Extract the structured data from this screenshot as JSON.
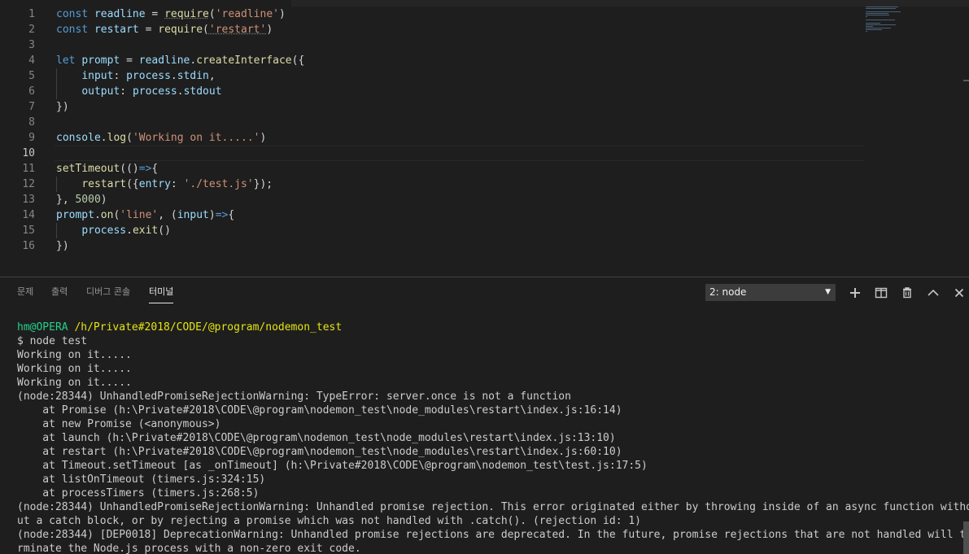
{
  "editor": {
    "current_line": 10,
    "lines": [
      {
        "n": "1",
        "tokens": [
          [
            "kw",
            "const "
          ],
          [
            "var",
            "readline"
          ],
          [
            "punc",
            " = "
          ],
          [
            "fn squig",
            "require"
          ],
          [
            "punc",
            "("
          ],
          [
            "str",
            "'readline'"
          ],
          [
            "punc",
            ")"
          ]
        ]
      },
      {
        "n": "2",
        "tokens": [
          [
            "kw",
            "const "
          ],
          [
            "var",
            "restart"
          ],
          [
            "punc",
            " = "
          ],
          [
            "fn",
            "require"
          ],
          [
            "punc",
            "("
          ],
          [
            "str squig",
            "'restart'"
          ],
          [
            "punc",
            ")"
          ]
        ]
      },
      {
        "n": "3",
        "tokens": []
      },
      {
        "n": "4",
        "tokens": [
          [
            "kw",
            "let "
          ],
          [
            "var",
            "prompt"
          ],
          [
            "punc",
            " = "
          ],
          [
            "var",
            "readline"
          ],
          [
            "punc",
            "."
          ],
          [
            "fn",
            "createInterface"
          ],
          [
            "punc",
            "({"
          ]
        ]
      },
      {
        "n": "5",
        "tokens": [
          [
            "punc",
            "    "
          ],
          [
            "var",
            "input"
          ],
          [
            "punc",
            ": "
          ],
          [
            "var",
            "process"
          ],
          [
            "punc",
            "."
          ],
          [
            "var",
            "stdin"
          ],
          [
            "punc",
            ","
          ]
        ]
      },
      {
        "n": "6",
        "tokens": [
          [
            "punc",
            "    "
          ],
          [
            "var",
            "output"
          ],
          [
            "punc",
            ": "
          ],
          [
            "var",
            "process"
          ],
          [
            "punc",
            "."
          ],
          [
            "var",
            "stdout"
          ]
        ]
      },
      {
        "n": "7",
        "tokens": [
          [
            "punc",
            "})"
          ]
        ]
      },
      {
        "n": "8",
        "tokens": []
      },
      {
        "n": "9",
        "tokens": [
          [
            "var",
            "console"
          ],
          [
            "punc",
            "."
          ],
          [
            "fn",
            "log"
          ],
          [
            "punc",
            "("
          ],
          [
            "str",
            "'Working on it.....'"
          ],
          [
            "punc",
            ")"
          ]
        ]
      },
      {
        "n": "10",
        "tokens": []
      },
      {
        "n": "11",
        "tokens": [
          [
            "fn",
            "setTimeout"
          ],
          [
            "punc",
            "(()"
          ],
          [
            "kw",
            "=>"
          ],
          [
            "punc",
            "{"
          ]
        ]
      },
      {
        "n": "12",
        "tokens": [
          [
            "punc",
            "    "
          ],
          [
            "fn",
            "restart"
          ],
          [
            "punc",
            "({"
          ],
          [
            "var",
            "entry"
          ],
          [
            "punc",
            ": "
          ],
          [
            "str",
            "'./test.js'"
          ],
          [
            "punc",
            "});"
          ]
        ]
      },
      {
        "n": "13",
        "tokens": [
          [
            "punc",
            "}, "
          ],
          [
            "num",
            "5000"
          ],
          [
            "punc",
            ")"
          ]
        ]
      },
      {
        "n": "14",
        "tokens": [
          [
            "var",
            "prompt"
          ],
          [
            "punc",
            "."
          ],
          [
            "fn",
            "on"
          ],
          [
            "punc",
            "("
          ],
          [
            "str",
            "'line'"
          ],
          [
            "punc",
            ", ("
          ],
          [
            "var",
            "input"
          ],
          [
            "punc",
            ")"
          ],
          [
            "kw",
            "=>"
          ],
          [
            "punc",
            "{"
          ]
        ]
      },
      {
        "n": "15",
        "tokens": [
          [
            "punc",
            "    "
          ],
          [
            "var",
            "process"
          ],
          [
            "punc",
            "."
          ],
          [
            "fn",
            "exit"
          ],
          [
            "punc",
            "()"
          ]
        ]
      },
      {
        "n": "16",
        "tokens": [
          [
            "punc",
            "})"
          ]
        ]
      }
    ]
  },
  "panel": {
    "tabs": [
      "문제",
      "출력",
      "디버그 콘솔",
      "터미널"
    ],
    "active_tab": "터미널",
    "terminal_select": "2: node",
    "actions": [
      "plus-icon",
      "split-icon",
      "trash-icon",
      "chevron-up-icon",
      "close-icon"
    ]
  },
  "terminal": {
    "prompt_user": "hm@OPERA",
    "prompt_path": "/h/Private#2018/CODE/@program/nodemon_test",
    "lines": [
      "$ node test",
      "Working on it.....",
      "Working on it.....",
      "Working on it.....",
      "(node:28344) UnhandledPromiseRejectionWarning: TypeError: server.once is not a function",
      "    at Promise (h:\\Private#2018\\CODE\\@program\\nodemon_test\\node_modules\\restart\\index.js:16:14)",
      "    at new Promise (<anonymous>)",
      "    at launch (h:\\Private#2018\\CODE\\@program\\nodemon_test\\node_modules\\restart\\index.js:13:10)",
      "    at restart (h:\\Private#2018\\CODE\\@program\\nodemon_test\\node_modules\\restart\\index.js:60:10)",
      "    at Timeout.setTimeout [as _onTimeout] (h:\\Private#2018\\CODE\\@program\\nodemon_test\\test.js:17:5)",
      "    at listOnTimeout (timers.js:324:15)",
      "    at processTimers (timers.js:268:5)",
      "(node:28344) UnhandledPromiseRejectionWarning: Unhandled promise rejection. This error originated either by throwing inside of an async function witho",
      "ut a catch block, or by rejecting a promise which was not handled with .catch(). (rejection id: 1)",
      "(node:28344) [DEP0018] DeprecationWarning: Unhandled promise rejections are deprecated. In the future, promise rejections that are not handled will te",
      "rminate the Node.js process with a non-zero exit code."
    ]
  }
}
